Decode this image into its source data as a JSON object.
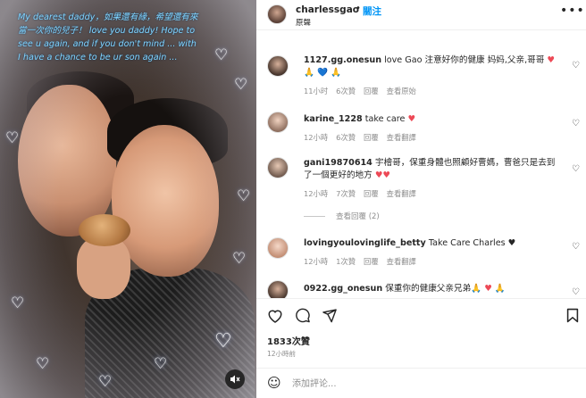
{
  "media": {
    "overlay_lines": [
      "My dearest daddy，如果還有緣，希望還有來",
      "當一次你的兒子！ love you daddy! Hope to",
      "see u again, and if you don't mind ... with",
      "I have a chance to be ur son again ..."
    ],
    "mute_icon": "speaker-muted-icon"
  },
  "header": {
    "username": "charlessgao",
    "separator": "•",
    "follow_label": "關注",
    "subtitle": "原聲"
  },
  "comments": [
    {
      "user": "1127.gg.onesun",
      "text_line1": "love Gao 注意好你的健康 妈妈,父亲,哥哥 ",
      "text_line2": "🙏 💙 🙏",
      "time": "11小时",
      "likes": "6次贊",
      "reply": "回覆",
      "extra": "查看原始"
    },
    {
      "user": "karine_1228",
      "text_line1": "take care ",
      "time": "12小時",
      "likes": "6次贊",
      "reply": "回覆",
      "extra": "查看翻譯"
    },
    {
      "user": "gani19870614",
      "text_line1": "宇檜哥，保重身體也照顧好曹媽，曹爸只是去到",
      "text_line2": "了一個更好的地方 ",
      "time": "12小時",
      "likes": "7次贊",
      "reply": "回覆",
      "extra": "查看翻譯"
    },
    {
      "user": "lovingyoulovinglife_betty",
      "text_line1": "Take Care Charles ",
      "time": "12小時",
      "likes": "1次贊",
      "reply": "回覆",
      "extra": "查看翻譯"
    },
    {
      "user": "0922.gg_onesun",
      "text_line1": "保重你的健康父亲兄弟🙏 ",
      "text_line2": "🙏"
    }
  ],
  "view_replies": "查看回覆 (2)",
  "likes": "1833次贊",
  "date": "12小時前",
  "add_comment_placeholder": "添加評论..."
}
